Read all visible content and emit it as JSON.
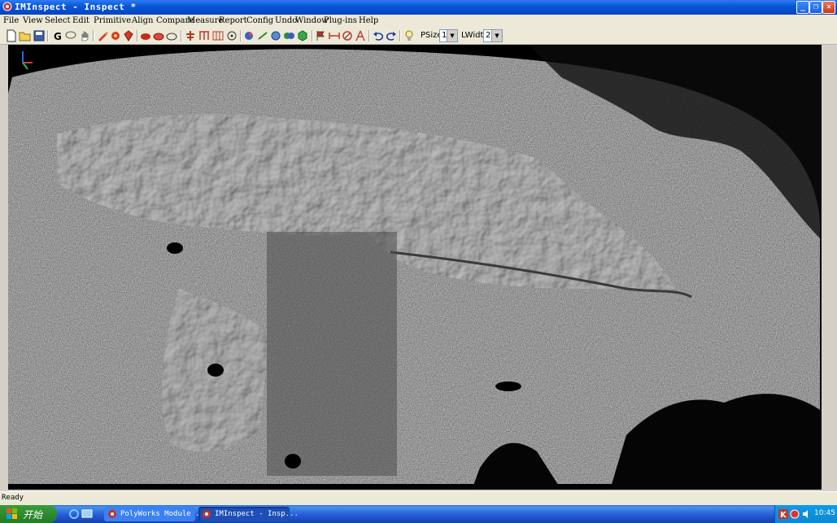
{
  "window": {
    "title": "IMInspect - Inspect *",
    "controls": {
      "minimize": "_",
      "maximize": "❐",
      "close": "✕"
    }
  },
  "menu": [
    "File",
    "View",
    "Select",
    "Edit",
    "Primitive",
    "Align",
    "Compare",
    "Measure",
    "Report",
    "Config",
    "Undo",
    "Window",
    "Plug-ins",
    "Help"
  ],
  "toolbar": {
    "psize_label": "PSize",
    "psize_value": "1",
    "lwidth_label": "LWidth",
    "lwidth_value": "2",
    "icons": [
      "new-icon",
      "open-icon",
      "save-icon",
      "g-icon",
      "lasso-icon",
      "hand-icon",
      "brush-icon",
      "paint-icon",
      "paint-bucket-icon",
      "shape-a-icon",
      "shape-b-icon",
      "shape-c-icon",
      "tree-icon",
      "grid-icon",
      "table-icon",
      "target-icon",
      "cube-icon",
      "line-icon",
      "sphere-a-icon",
      "sphere-b-icon",
      "box-icon",
      "flag-icon",
      "dimension-icon",
      "arc-icon",
      "measure-icon",
      "undo-icon",
      "redo-icon",
      "bulb-icon"
    ]
  },
  "status": {
    "text": "Ready"
  },
  "taskbar": {
    "start_label": "开始",
    "tasks": [
      "PolyWorks Module ...",
      "IMInspect - Insp..."
    ],
    "clock": "10:45"
  },
  "colors": {
    "titlebar": "#0a58d8",
    "viewport_bg": "#000000",
    "taskbar": "#2157d7"
  }
}
